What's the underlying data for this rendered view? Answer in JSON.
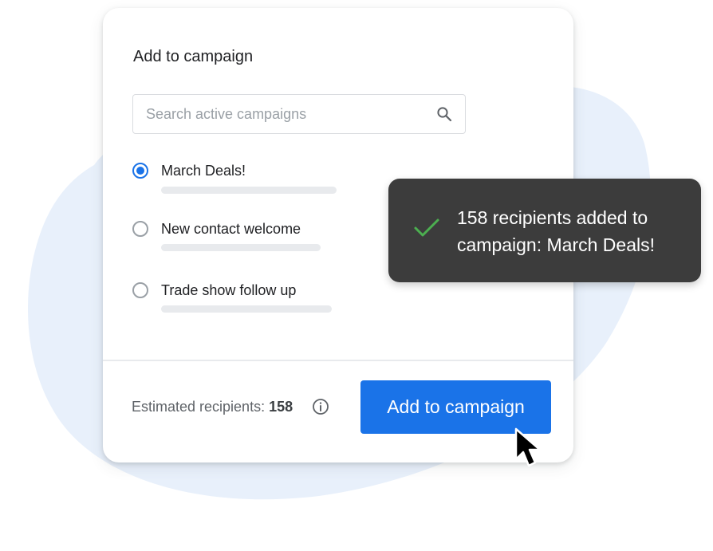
{
  "dialog": {
    "title": "Add to campaign",
    "search": {
      "placeholder": "Search active campaigns",
      "value": "",
      "icon": "search-icon"
    },
    "campaigns": [
      {
        "label": "March Deals!",
        "selected": true
      },
      {
        "label": "New contact welcome",
        "selected": false
      },
      {
        "label": "Trade show follow up",
        "selected": false
      }
    ],
    "footer": {
      "estimate_label": "Estimated recipients:",
      "estimate_count": "158",
      "info_icon": "info-icon",
      "button_label": "Add to campaign"
    }
  },
  "toast": {
    "icon": "check-icon",
    "message": "158 recipients added to campaign: March Deals!"
  },
  "colors": {
    "accent": "#1a73e8",
    "toast_background": "#3c3c3c",
    "success": "#4caf50",
    "backdrop": "#e8f0fb"
  }
}
